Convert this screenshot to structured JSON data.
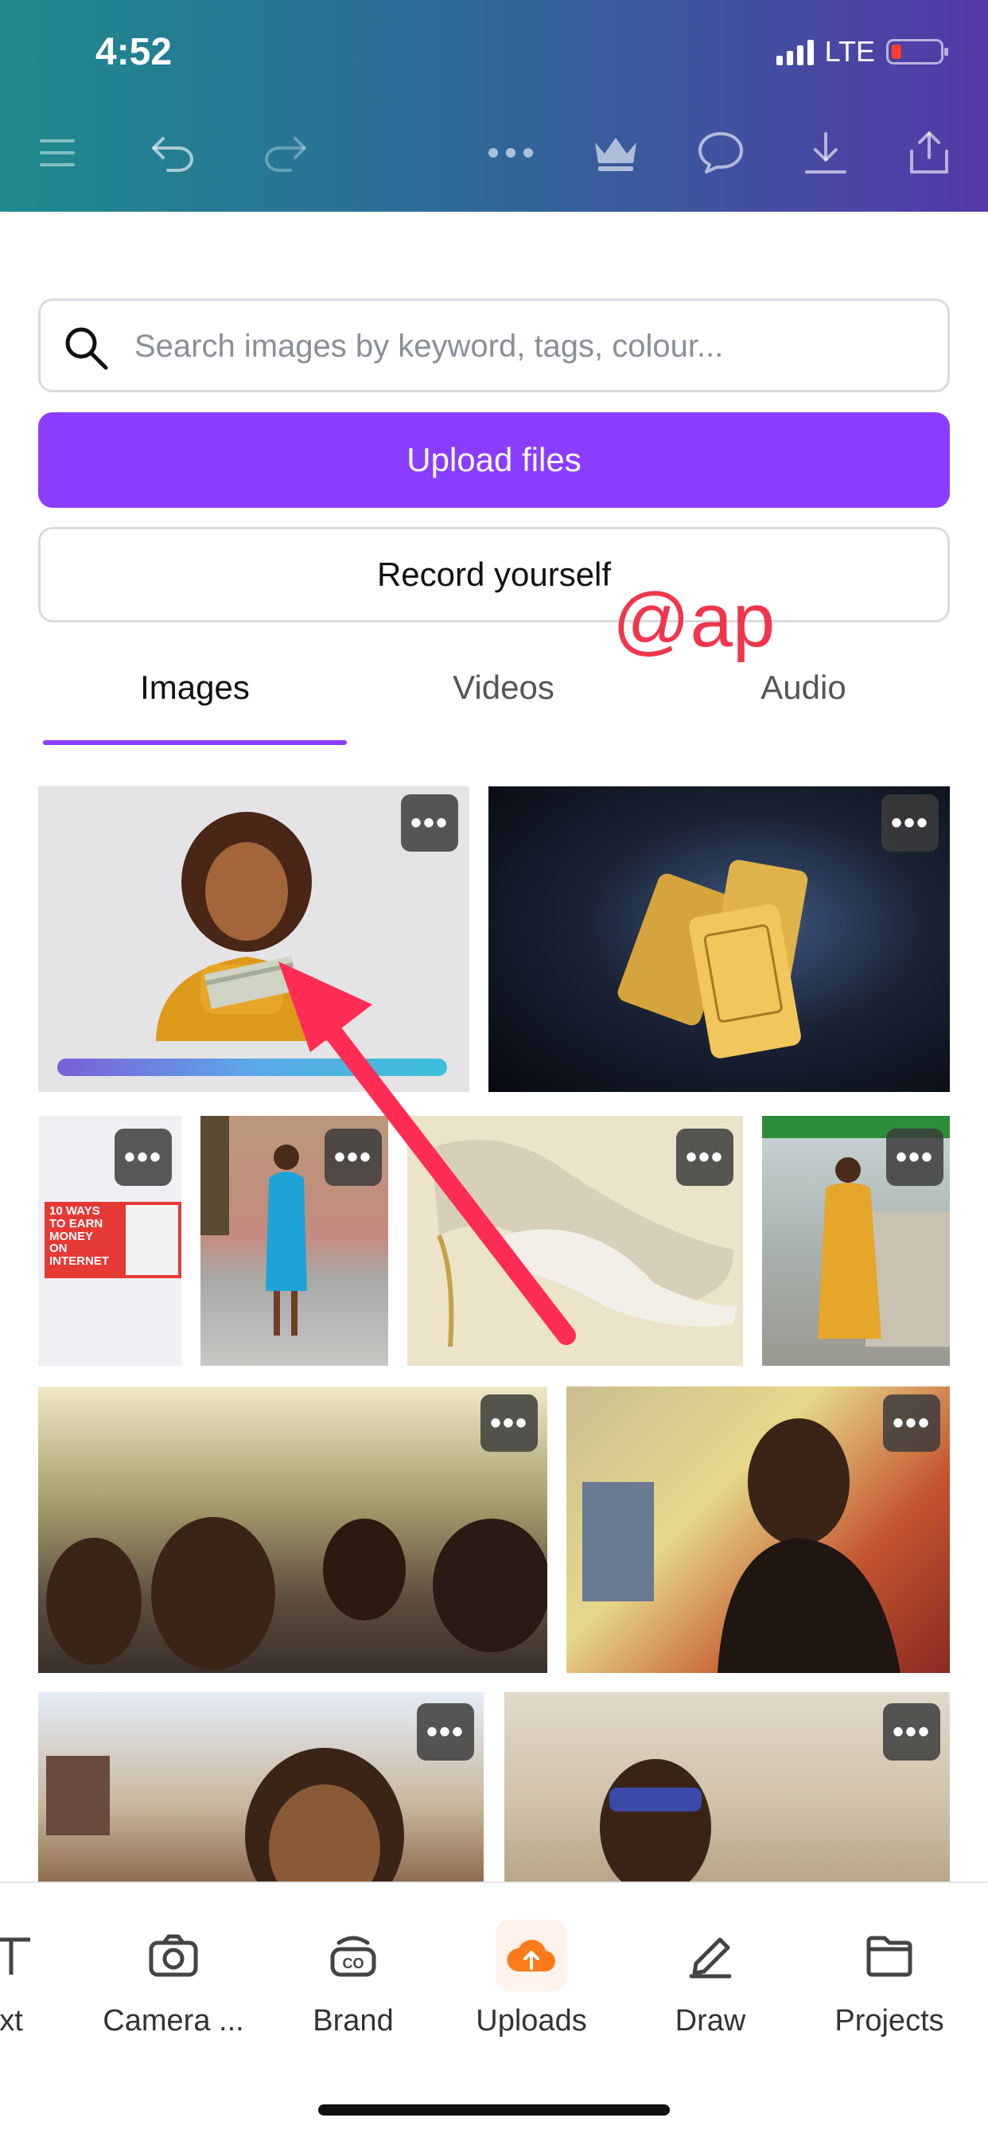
{
  "status_bar": {
    "time": "4:52",
    "network": "LTE",
    "battery_color": "#ff3b30"
  },
  "toolbar": {
    "icons": [
      "menu-icon",
      "undo-icon",
      "redo-icon",
      "more-icon",
      "crown-icon",
      "comment-icon",
      "download-icon",
      "share-icon"
    ]
  },
  "search": {
    "placeholder": "Search images by keyword, tags, colour..."
  },
  "actions": {
    "upload_label": "Upload files",
    "record_label": "Record yourself"
  },
  "watermark": "@ap",
  "tabs": {
    "images": "Images",
    "videos": "Videos",
    "audio": "Audio",
    "active": "Images"
  },
  "thumbnail": {
    "more_label": "•••",
    "upload_progress": 1.0,
    "items": [
      {
        "name": "woman-with-money",
        "overlay_text": ""
      },
      {
        "name": "gold-bars",
        "overlay_text": ""
      },
      {
        "name": "earn-money-graphic",
        "overlay_text": "10 WAYS TO EARN MONEY ON INTERNET"
      },
      {
        "name": "woman-blue-dress",
        "overlay_text": ""
      },
      {
        "name": "heels-shoes",
        "overlay_text": ""
      },
      {
        "name": "woman-yellow-dress",
        "overlay_text": ""
      },
      {
        "name": "hall-audience",
        "overlay_text": ""
      },
      {
        "name": "woman-selfie-hall",
        "overlay_text": ""
      },
      {
        "name": "woman-eating",
        "overlay_text": ""
      },
      {
        "name": "woman-sunglasses",
        "overlay_text": ""
      }
    ]
  },
  "bottom_nav": {
    "items": [
      {
        "label": "xt",
        "icon": "text-icon"
      },
      {
        "label": "Camera ...",
        "icon": "camera-icon"
      },
      {
        "label": "Brand",
        "icon": "brand-icon"
      },
      {
        "label": "Uploads",
        "icon": "upload-cloud-icon"
      },
      {
        "label": "Draw",
        "icon": "pen-icon"
      },
      {
        "label": "Projects",
        "icon": "folder-icon"
      }
    ]
  },
  "colors": {
    "accent": "#8b3dff",
    "upload_icon": "#ff7a1a",
    "watermark": "#f0364d"
  }
}
